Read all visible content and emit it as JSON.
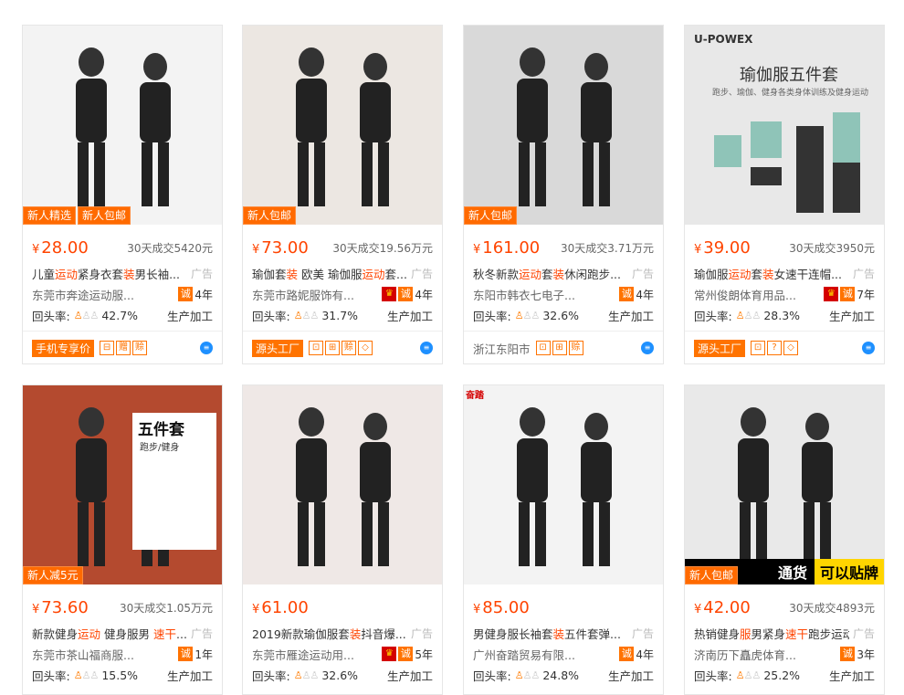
{
  "cards": [
    {
      "tags": [
        "新人精选",
        "新人包邮"
      ],
      "price": "28.00",
      "sold": "30天成交5420元",
      "title_prefix": "儿童",
      "title_hl1": "运动",
      "title_mid": "紧身衣套",
      "title_hl2": "装",
      "title_rest": "男长袖...",
      "ad": "广告",
      "company": "东莞市奔途运动服...",
      "years": "4年",
      "rate_label": "回头率:",
      "rate": "42.7%",
      "type": "生产加工",
      "bottom_badge": "手机专享价",
      "bottom_icons": [
        "⊟",
        "赠",
        "赊"
      ],
      "bottom_loc": "",
      "img_bg": "#f3f3f3"
    },
    {
      "tags": [
        "新人包邮"
      ],
      "price": "73.00",
      "sold": "30天成交19.56万元",
      "title_prefix": "瑜伽套",
      "title_hl1": "装",
      "title_mid": " 欧美 瑜伽服",
      "title_hl2": "运动",
      "title_rest": "套...",
      "ad": "广告",
      "company": "东莞市路妮服饰有...",
      "years": "4年",
      "rate_label": "回头率:",
      "rate": "31.7%",
      "type": "生产加工",
      "bottom_badge": "源头工厂",
      "bottom_icons": [
        "⊡",
        "⊞",
        "赊",
        "◇"
      ],
      "bottom_loc": "",
      "img_bg": "#ece7e2"
    },
    {
      "tags": [
        "新人包邮"
      ],
      "price": "161.00",
      "sold": "30天成交3.71万元",
      "title_prefix": "秋冬新款",
      "title_hl1": "运动",
      "title_mid": "套",
      "title_hl2": "装",
      "title_rest": "休闲跑步...",
      "ad": "广告",
      "company": "东阳市韩衣七电子...",
      "years": "4年",
      "rate_label": "回头率:",
      "rate": "32.6%",
      "type": "生产加工",
      "bottom_badge": "",
      "bottom_icons": [
        "⊡",
        "⊞",
        "赊"
      ],
      "bottom_loc": "浙江东阳市",
      "img_bg": "#d9d9d9"
    },
    {
      "tags": [],
      "price": "39.00",
      "sold": "30天成交3950元",
      "title_prefix": "瑜伽服",
      "title_hl1": "运动",
      "title_mid": "套",
      "title_hl2": "装",
      "title_rest": "女速干连帽...",
      "ad": "广告",
      "company": "常州俊朗体育用品...",
      "years": "7年",
      "rate_label": "回头率:",
      "rate": "28.3%",
      "type": "生产加工",
      "bottom_badge": "源头工厂",
      "bottom_icons": [
        "⊡",
        "?",
        "◇"
      ],
      "bottom_loc": "",
      "img_bg": "#e6e6e6"
    },
    {
      "tags": [
        "新人减5元"
      ],
      "price": "73.60",
      "sold": "30天成交1.05万元",
      "title_prefix": "新款健身",
      "title_hl1": "运动",
      "title_mid": " 健身服男 ",
      "title_hl2": "速干",
      "title_rest": "...",
      "ad": "广告",
      "company": "东莞市茶山福商服...",
      "years": "1年",
      "rate_label": "回头率:",
      "rate": "15.5%",
      "type": "生产加工",
      "bottom_badge": "",
      "bottom_icons": [],
      "bottom_loc": "",
      "img_bg": "#b44a2f"
    },
    {
      "tags": [],
      "price": "61.00",
      "sold": "",
      "title_prefix": "2019新款瑜伽服套",
      "title_hl1": "装",
      "title_mid": "抖音爆...",
      "title_hl2": "",
      "title_rest": "",
      "ad": "广告",
      "company": "东莞市雁途运动用...",
      "years": "5年",
      "rate_label": "回头率:",
      "rate": "32.6%",
      "type": "生产加工",
      "bottom_badge": "",
      "bottom_icons": [],
      "bottom_loc": "",
      "img_bg": "#efe8e6"
    },
    {
      "tags": [],
      "price": "85.00",
      "sold": "",
      "title_prefix": "男健身服长袖套",
      "title_hl1": "装",
      "title_mid": "五件套弹...",
      "title_hl2": "",
      "title_rest": "",
      "ad": "广告",
      "company": "广州奋踏贸易有限...",
      "years": "4年",
      "rate_label": "回头率:",
      "rate": "24.8%",
      "type": "生产加工",
      "bottom_badge": "",
      "bottom_icons": [],
      "bottom_loc": "",
      "img_bg": "#f3f3f3"
    },
    {
      "tags": [
        "新人包邮"
      ],
      "price": "42.00",
      "sold": "30天成交4893元",
      "title_prefix": "热销健身",
      "title_hl1": "服",
      "title_mid": "男紧身",
      "title_hl2": "速干",
      "title_rest": "跑步运动套...",
      "ad": "广告",
      "company": "济南历下矗虎体育...",
      "years": "3年",
      "rate_label": "回头率:",
      "rate": "25.2%",
      "type": "生产加工",
      "bottom_badge": "",
      "bottom_icons": [],
      "bottom_loc": "",
      "img_bg": "#e9e9e9"
    }
  ],
  "banner_texts": {
    "c4_logo": "U-POWEX",
    "c4_title": "瑜伽服五件套",
    "c4_sub": "跑步、瑜伽、健身各类身体训练及健身运动",
    "c5_title": "五件套",
    "c5_sub": "跑步/健身",
    "c7_logo": "奋踏",
    "c8_banner1": "通货",
    "c8_banner2": "可以贴牌"
  },
  "colors": {
    "accent": "#ff4400",
    "tag": "#ff6a00"
  },
  "currency": "¥"
}
